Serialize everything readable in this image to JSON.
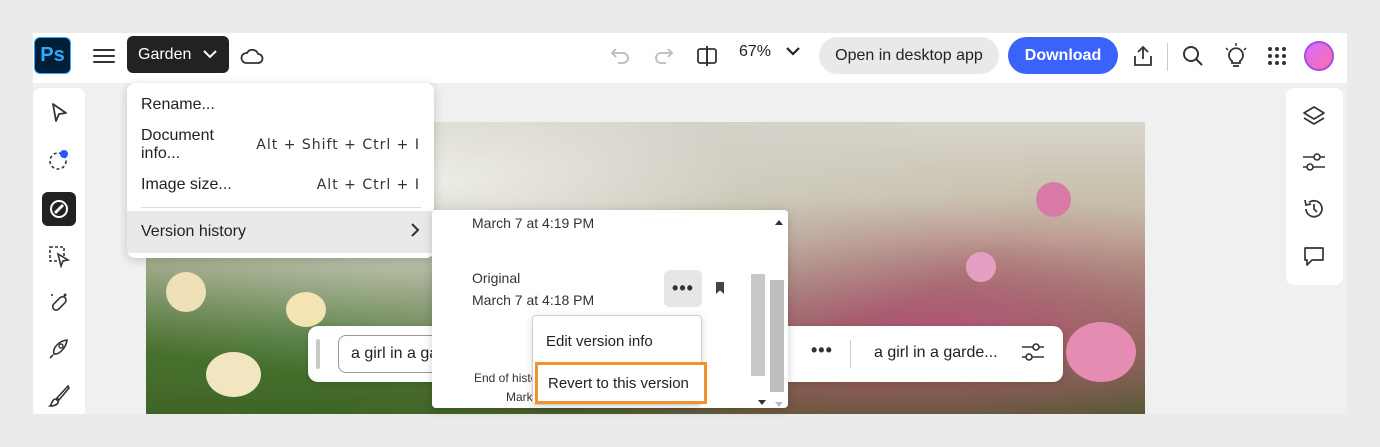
{
  "app": {
    "logo": "Ps",
    "accent": "#3b63fb"
  },
  "header": {
    "document_name": "Garden",
    "zoom_value": "67%",
    "open_desktop_label": "Open in desktop app",
    "download_label": "Download"
  },
  "document_menu": {
    "items": [
      {
        "label": "Rename...",
        "shortcut": ""
      },
      {
        "label": "Document info...",
        "shortcut": "Alt + Shift + Ctrl + I"
      },
      {
        "label": "Image size...",
        "shortcut": "Alt + Ctrl + I"
      },
      {
        "label": "Version history",
        "shortcut": ""
      }
    ]
  },
  "version_history": {
    "entry_top_date": "March 7 at 4:19 PM",
    "original_title": "Original",
    "original_date": "March 7 at 4:18 PM",
    "end_of_history": "End of histo",
    "end_of_history_line2": "Mark"
  },
  "version_actions": {
    "edit_label": "Edit version info",
    "revert_label": "Revert to this version"
  },
  "prompt_bar": {
    "left_value": "a girl in a ga",
    "right_value": "a girl in a garde..."
  },
  "icons": {
    "left_rail": [
      "select-icon",
      "quick-select-icon",
      "adjust-icon",
      "object-select-icon",
      "healing-icon",
      "quick-actions-icon",
      "brush-icon"
    ],
    "right_rail": [
      "layers-icon",
      "adjustments-icon",
      "history-icon",
      "comments-icon"
    ]
  }
}
